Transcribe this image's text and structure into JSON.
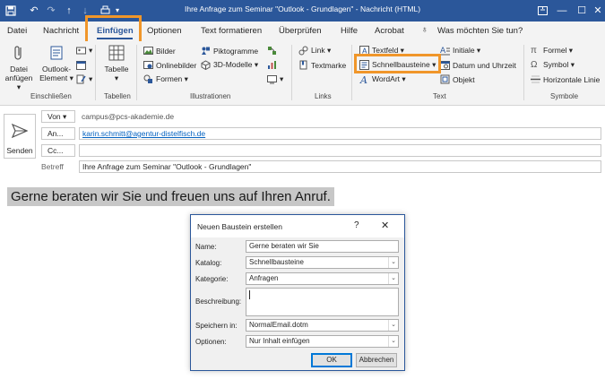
{
  "window": {
    "title": "Ihre Anfrage zum Seminar \"Outlook - Grundlagen\"  -  Nachricht (HTML)"
  },
  "tabs": [
    {
      "label": "Datei"
    },
    {
      "label": "Nachricht"
    },
    {
      "label": "Einfügen",
      "active": true
    },
    {
      "label": "Optionen"
    },
    {
      "label": "Text formatieren"
    },
    {
      "label": "Überprüfen"
    },
    {
      "label": "Hilfe"
    },
    {
      "label": "Acrobat"
    },
    {
      "label": "Was möchten Sie tun?",
      "icon": "lightbulb-icon"
    }
  ],
  "ribbon": {
    "einschliessen": {
      "label": "Einschließen",
      "datei_anfuegen": [
        "Datei",
        "anfügen ▾"
      ],
      "outlook_element": [
        "Outlook-",
        "Element ▾"
      ]
    },
    "tabellen": {
      "label": "Tabellen",
      "tabelle": [
        "Tabelle",
        "▾"
      ]
    },
    "illustrationen": {
      "label": "Illustrationen",
      "bilder": "Bilder",
      "onlinebilder": "Onlinebilder",
      "formen": "Formen ▾",
      "piktogramme": "Piktogramme",
      "modelle3d": "3D-Modelle ▾"
    },
    "links": {
      "label": "Links",
      "link": "Link ▾",
      "textmarke": "Textmarke"
    },
    "text": {
      "label": "Text",
      "textfeld": "Textfeld ▾",
      "schnellbausteine": "Schnellbausteine ▾",
      "wordart": "WordArt ▾",
      "initiale": "Initiale ▾",
      "datum_uhrzeit": "Datum und Uhrzeit",
      "objekt": "Objekt"
    },
    "symbole": {
      "label": "Symbole",
      "formel": "Formel ▾",
      "symbol": "Symbol ▾",
      "horizontale_linie": "Horizontale Linie"
    }
  },
  "mail": {
    "send_label": "Senden",
    "von_label": "Von ▾",
    "von_value": "campus@pcs-akademie.de",
    "an_label": "An...",
    "an_value": "karin.schmitt@agentur-distelfisch.de",
    "cc_label": "Cc...",
    "cc_value": "",
    "betreff_label": "Betreff",
    "betreff_value": "Ihre Anfrage zum Seminar \"Outlook - Grundlagen\"",
    "body_text": "Gerne beraten wir Sie und freuen uns auf Ihren Anruf."
  },
  "dialog": {
    "title": "Neuen Baustein erstellen",
    "help": "?",
    "name_label": "Name:",
    "name_value": "Gerne beraten wir Sie",
    "katalog_label": "Katalog:",
    "katalog_value": "Schnellbausteine",
    "kategorie_label": "Kategorie:",
    "kategorie_value": "Anfragen",
    "beschreibung_label": "Beschreibung:",
    "speichern_label": "Speichern in:",
    "speichern_value": "NormalEmail.dotm",
    "optionen_label": "Optionen:",
    "optionen_value": "Nur Inhalt einfügen",
    "ok_label": "OK",
    "cancel_label": "Abbrechen"
  },
  "colors": {
    "titlebar": "#2b579a",
    "highlight": "#f0962a",
    "link": "#0563c1"
  }
}
